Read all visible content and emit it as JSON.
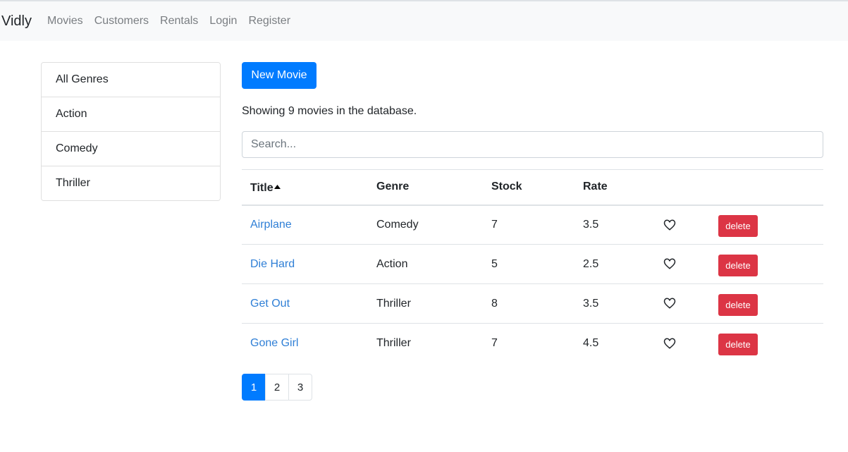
{
  "nav": {
    "brand": "Vidly",
    "links": [
      "Movies",
      "Customers",
      "Rentals",
      "Login",
      "Register"
    ]
  },
  "genres": [
    "All Genres",
    "Action",
    "Comedy",
    "Thriller"
  ],
  "main": {
    "new_movie_label": "New Movie",
    "count_text": "Showing 9 movies in the database.",
    "search_placeholder": "Search...",
    "columns": [
      "Title",
      "Genre",
      "Stock",
      "Rate"
    ],
    "sort_icon": "sort-up-icon",
    "rows": [
      {
        "title": "Airplane",
        "genre": "Comedy",
        "stock": "7",
        "rate": "3.5",
        "delete_label": "delete"
      },
      {
        "title": "Die Hard",
        "genre": "Action",
        "stock": "5",
        "rate": "2.5",
        "delete_label": "delete"
      },
      {
        "title": "Get Out",
        "genre": "Thriller",
        "stock": "8",
        "rate": "3.5",
        "delete_label": "delete"
      },
      {
        "title": "Gone Girl",
        "genre": "Thriller",
        "stock": "7",
        "rate": "4.5",
        "delete_label": "delete"
      }
    ],
    "pages": [
      "1",
      "2",
      "3"
    ],
    "active_page": "1"
  },
  "colors": {
    "primary": "#007bff",
    "danger": "#dc3545",
    "link": "#2f7fd6",
    "navbar_bg": "#f8f9fa"
  }
}
